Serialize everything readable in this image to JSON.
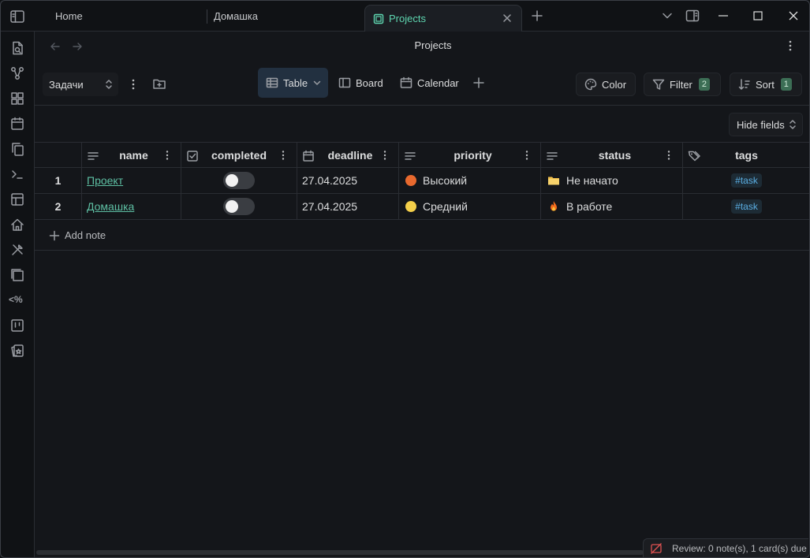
{
  "tabs": [
    {
      "label": "Home"
    },
    {
      "label": "Домашка"
    },
    {
      "label": "Projects"
    }
  ],
  "view": {
    "title": "Projects"
  },
  "toolbar": {
    "base_select": "Задачи",
    "views": [
      {
        "label": "Table"
      },
      {
        "label": "Board"
      },
      {
        "label": "Calendar"
      }
    ],
    "color_label": "Color",
    "filter_label": "Filter",
    "filter_count": "2",
    "sort_label": "Sort",
    "sort_count": "1",
    "hide_fields_label": "Hide fields"
  },
  "table": {
    "columns": [
      {
        "label": "name"
      },
      {
        "label": "completed"
      },
      {
        "label": "deadline"
      },
      {
        "label": "priority"
      },
      {
        "label": "status"
      },
      {
        "label": "tags"
      }
    ],
    "rows": [
      {
        "index": "1",
        "name": "Проект",
        "completed": false,
        "deadline": "27.04.2025",
        "priority": "Высокий",
        "priority_color": "#e8692e",
        "status": "Не начато",
        "status_icon": "folder-icon",
        "tag": "#task"
      },
      {
        "index": "2",
        "name": "Домашка",
        "completed": false,
        "deadline": "27.04.2025",
        "priority": "Средний",
        "priority_color": "#f4cf4a",
        "status": "В работе",
        "status_icon": "fire-icon",
        "tag": "#task"
      }
    ],
    "add_note_label": "Add note"
  },
  "ribbon": {
    "templater_label": "<%"
  },
  "status_bar": {
    "review_text": "Review: 0 note(s), 1 card(s) due"
  },
  "colors": {
    "accent": "#5ed6b0",
    "link": "#5ebfa3",
    "tag": "#5aaee3",
    "badge": "#3c6e55"
  }
}
